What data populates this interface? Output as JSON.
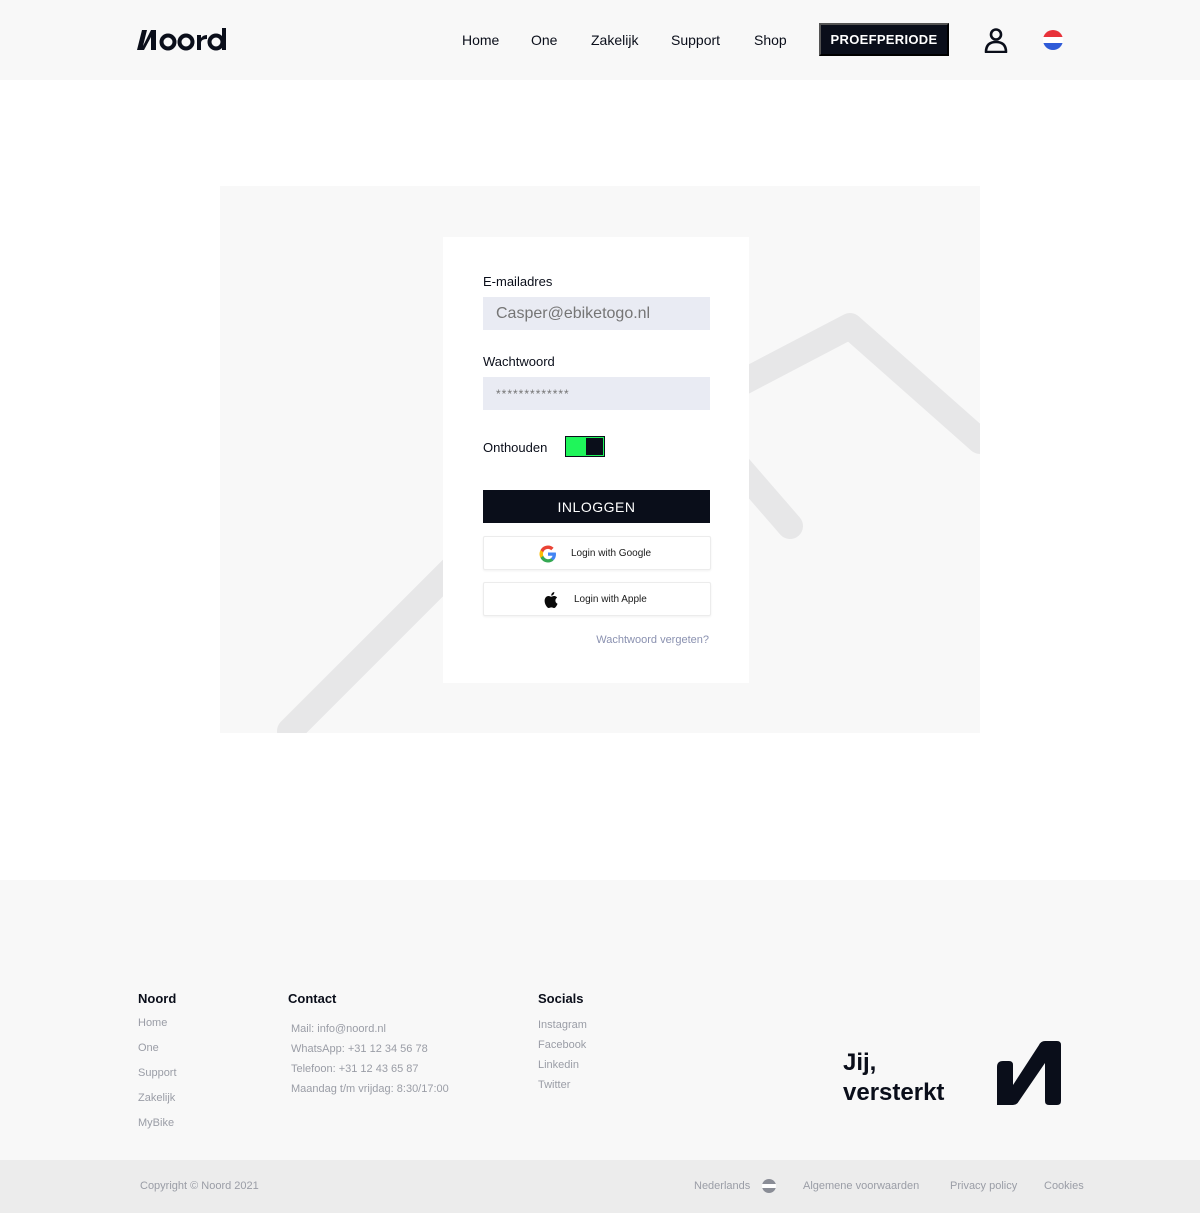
{
  "header": {
    "logo_text": "Noord",
    "nav": [
      "Home",
      "One",
      "Zakelijk",
      "Support",
      "Shop"
    ],
    "cta_label": "PROEFPERIODE",
    "user_icon": "user-icon",
    "flag_icon": "netherlands-flag-icon"
  },
  "login": {
    "email_label": "E-mailadres",
    "email_placeholder": "Casper@ebiketogo.nl",
    "password_label": "Wachtwoord",
    "password_placeholder": "*************",
    "remember_label": "Onthouden",
    "remember_on": true,
    "login_button": "INLOGGEN",
    "google_button": "Login with Google",
    "apple_button": "Login with Apple",
    "forgot_link": "Wachtwoord vergeten?"
  },
  "footer": {
    "columns": [
      {
        "heading": "Noord",
        "links": [
          "Home",
          "One",
          "Support",
          "Zakelijk",
          "MyBike"
        ]
      },
      {
        "heading": "Contact",
        "links": [
          "Mail: info@noord.nl",
          "WhatsApp: +31 12 34 56 78",
          "Telefoon: +31 12 43 65 87",
          "Maandag t/m vrijdag: 8:30/17:00"
        ]
      },
      {
        "heading": "Socials",
        "links": [
          "Instagram",
          "Facebook",
          "Linkedin",
          "Twitter"
        ]
      }
    ],
    "slogan_line1": "Jij,",
    "slogan_line2": "versterkt"
  },
  "bottom_bar": {
    "copyright": "Copyright © Noord 2021",
    "language": "Nederlands",
    "terms": "Algemene voorwaarden",
    "privacy": "Privacy policy",
    "cookies": "Cookies"
  },
  "colors": {
    "primary": "#0a0e1a",
    "accent_green": "#1ff55a",
    "input_bg": "#e9ebf3",
    "muted_text": "#9a9da6",
    "link_blue": "#8a91b0"
  }
}
